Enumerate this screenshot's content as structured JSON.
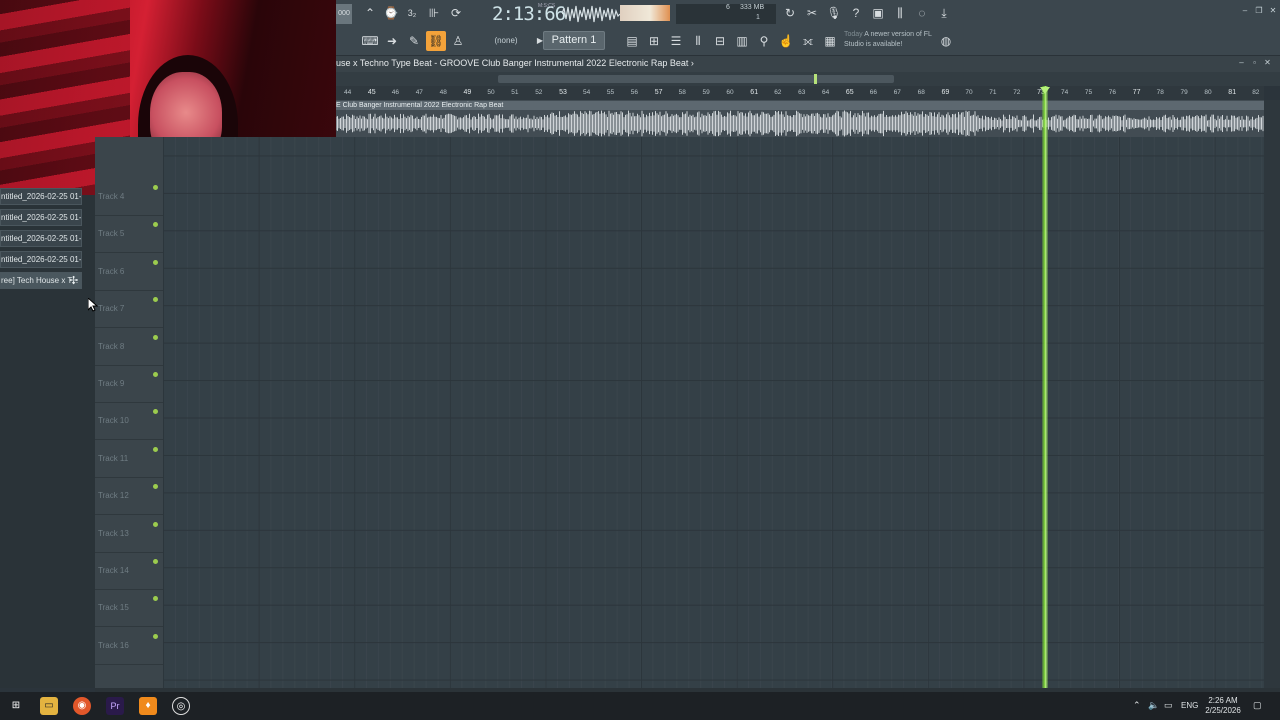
{
  "toolbar": {
    "time_display": "2:13:66",
    "time_unit": "M:S:CS",
    "cpu_number": "6",
    "memory": "333 MB",
    "poly": "1",
    "pattern_none": "(none)",
    "pattern_selected": "Pattern 1",
    "news_today": "Today",
    "news_text": "A newer version of FL Studio is available!",
    "tempo_partial": "000"
  },
  "playlist": {
    "title": "use x Techno Type Beat - GROOVE  Club Banger Instrumental 2022  Electronic Rap Beat ›",
    "clip_label": "E  Club Banger Instrumental 2022  Electronic Rap Beat",
    "ruler": [
      "44",
      "45",
      "46",
      "47",
      "48",
      "49",
      "50",
      "51",
      "52",
      "53",
      "54",
      "55",
      "56",
      "57",
      "58",
      "59",
      "60",
      "61",
      "62",
      "63",
      "64",
      "65",
      "66",
      "67",
      "68",
      "69",
      "70",
      "71",
      "72",
      "73",
      "74",
      "75",
      "76",
      "77",
      "78",
      "79",
      "80",
      "81",
      "82"
    ],
    "tracks": [
      "Track 4",
      "Track 5",
      "Track 6",
      "Track 7",
      "Track 8",
      "Track 9",
      "Track 10",
      "Track 11",
      "Track 12",
      "Track 13",
      "Track 14",
      "Track 15",
      "Track 16"
    ]
  },
  "browser": {
    "items": [
      "ntitled_2026-02-25 01-",
      "ntitled_2026-02-25 01-",
      "ntitled_2026-02-25 01-",
      "ntitled_2026-02-25 01-",
      "ree] Tech House x T..."
    ]
  },
  "taskbar": {
    "language": "ENG",
    "time": "2:26 AM",
    "date": "2/25/2026"
  },
  "colors": {
    "accent": "#f3a23a",
    "playhead": "#7ed43a",
    "grid_bg": "#344047"
  }
}
